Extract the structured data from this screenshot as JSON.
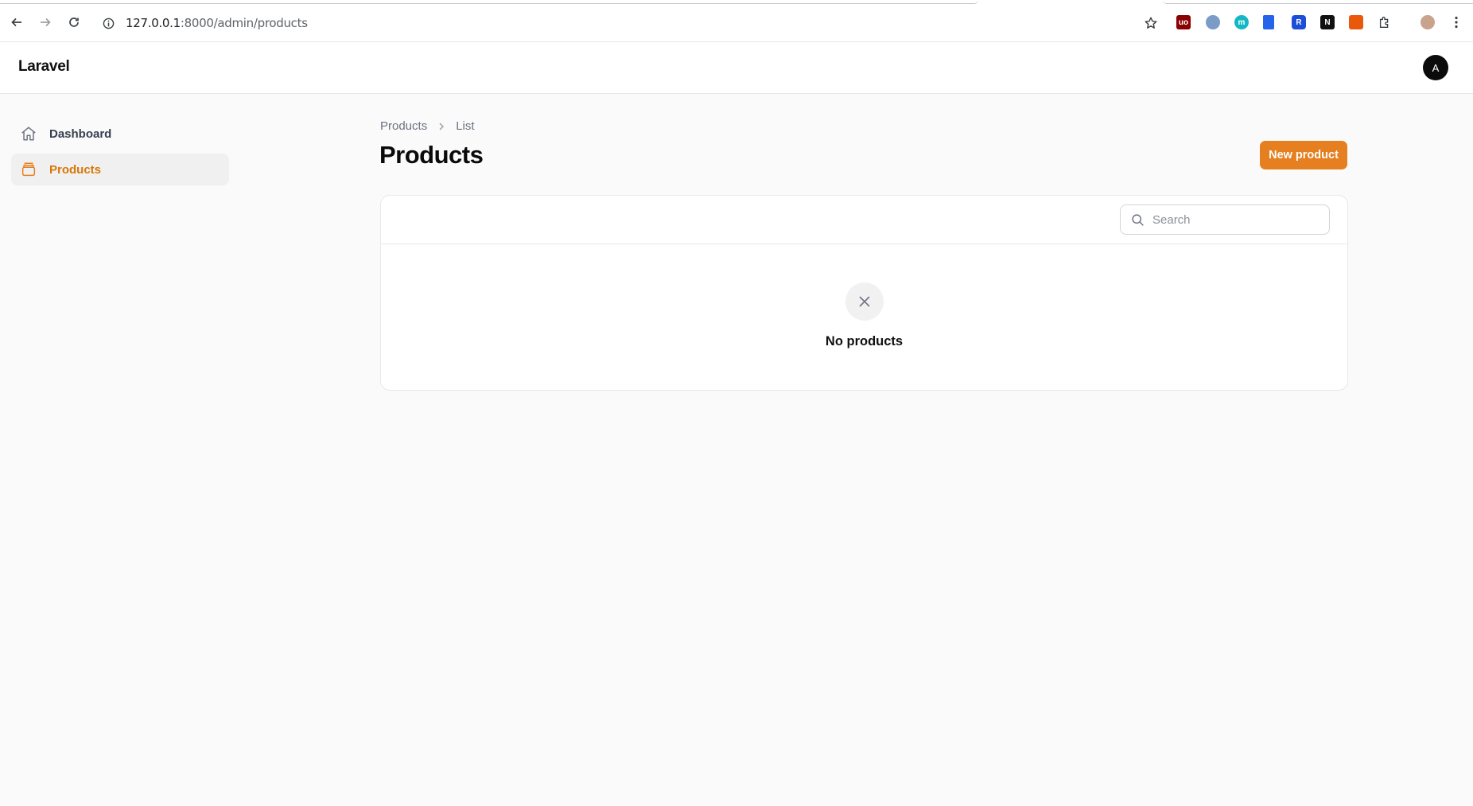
{
  "browser": {
    "url_host": "127.0.0.1",
    "url_path": ":8000/admin/products"
  },
  "header": {
    "brand": "Laravel",
    "avatar_initial": "A"
  },
  "sidebar": {
    "items": [
      {
        "label": "Dashboard",
        "icon": "home-icon",
        "active": false
      },
      {
        "label": "Products",
        "icon": "archive-box-icon",
        "active": true
      }
    ]
  },
  "main": {
    "breadcrumb": [
      "Products",
      "List"
    ],
    "title": "Products",
    "new_button_label": "New product",
    "search_placeholder": "Search",
    "empty_state_text": "No products"
  },
  "colors": {
    "accent": "#e57f1f",
    "active_text": "#d97706"
  }
}
